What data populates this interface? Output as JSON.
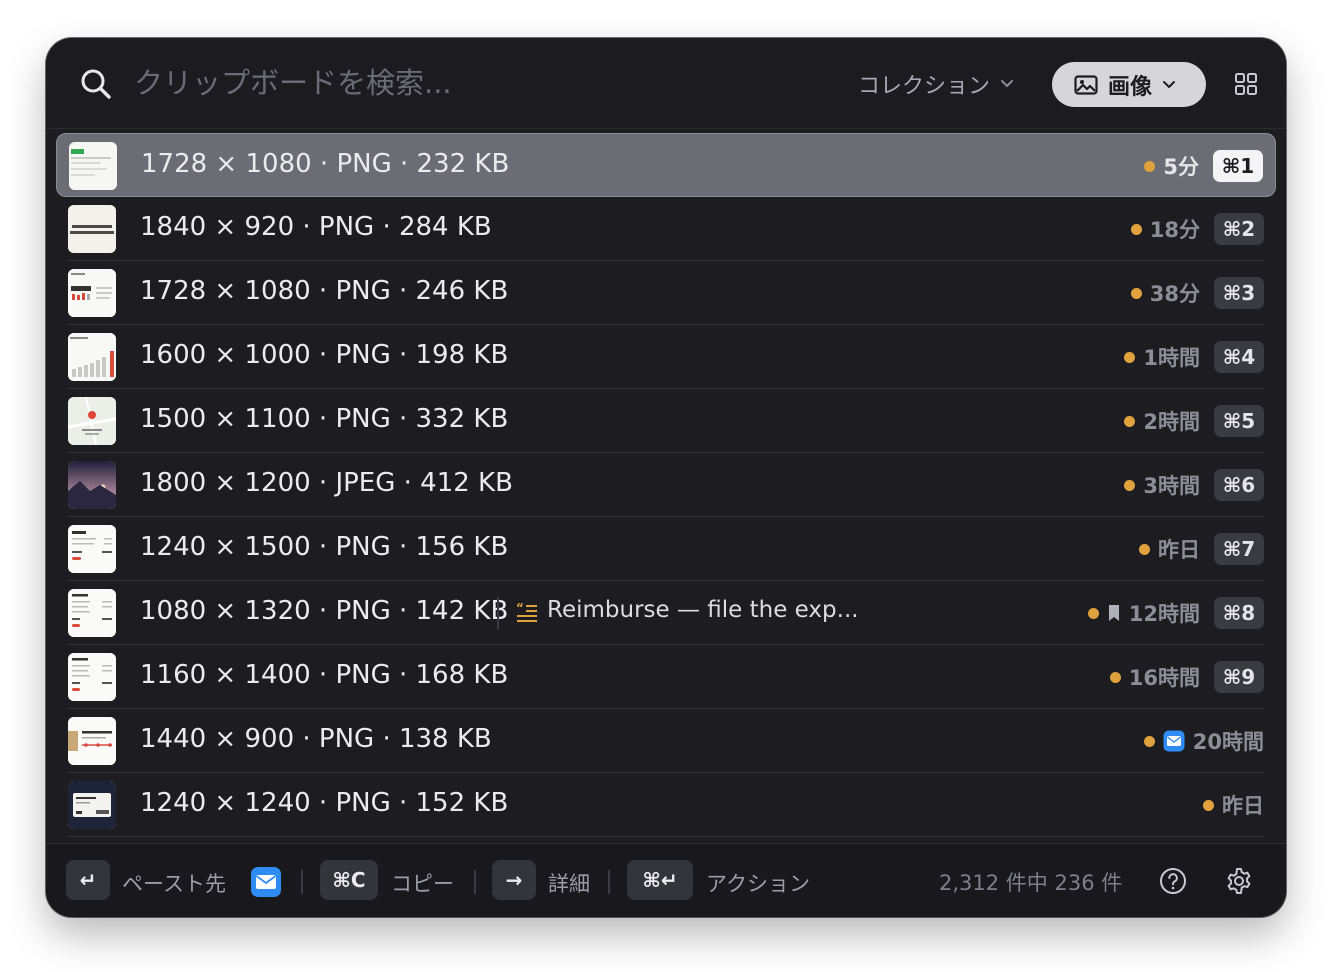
{
  "search": {
    "placeholder": "クリップボードを検索..."
  },
  "header": {
    "collection_label": "コレクション",
    "filter_label": "画像"
  },
  "colors": {
    "accent_dot": "#e0a23c",
    "selected_row": "#6c6c74",
    "window_bg": "#1c1c21"
  },
  "items": [
    {
      "title": "1728 × 1080 · PNG · 232 KB",
      "time": "5分",
      "shortcut": "⌘1",
      "selected": true,
      "thumb": "doc-green"
    },
    {
      "title": "1840 × 920 · PNG · 284 KB",
      "time": "18分",
      "shortcut": "⌘2",
      "thumb": "slide-text"
    },
    {
      "title": "1728 × 1080 · PNG · 246 KB",
      "time": "38分",
      "shortcut": "⌘3",
      "thumb": "dashboard"
    },
    {
      "title": "1600 × 1000 · PNG · 198 KB",
      "time": "1時間",
      "shortcut": "⌘4",
      "thumb": "bar-chart"
    },
    {
      "title": "1500 × 1100 · PNG · 332 KB",
      "time": "2時間",
      "shortcut": "⌘5",
      "thumb": "map"
    },
    {
      "title": "1800 × 1200 · JPEG · 412 KB",
      "time": "3時間",
      "shortcut": "⌘6",
      "thumb": "landscape"
    },
    {
      "title": "1240 × 1500 · PNG · 156 KB",
      "time": "昨日",
      "shortcut": "⌘7",
      "thumb": "invoice"
    },
    {
      "title": "1080 × 1320 · PNG · 142 KB",
      "time": "12時間",
      "shortcut": "⌘8",
      "thumb": "receipt",
      "note": "Reimburse — file the exp...",
      "bookmarked": true
    },
    {
      "title": "1160 × 1400 · PNG · 168 KB",
      "time": "16時間",
      "shortcut": "⌘9",
      "thumb": "receipt"
    },
    {
      "title": "1440 × 900 · PNG · 138 KB",
      "time": "20時間",
      "shortcut": "",
      "thumb": "shipping",
      "mail_source": true
    },
    {
      "title": "1240 × 1240 · PNG · 152 KB",
      "time": "昨日",
      "shortcut": "",
      "thumb": "ticket"
    }
  ],
  "footer": {
    "enter_key": "↵",
    "paste_label": "ペースト先",
    "copy_key": "⌘C",
    "copy_label": "コピー",
    "detail_key": "→",
    "detail_label": "詳細",
    "action_key": "⌘↵",
    "action_label": "アクション",
    "count_text": "2,312 件中 236 件"
  }
}
